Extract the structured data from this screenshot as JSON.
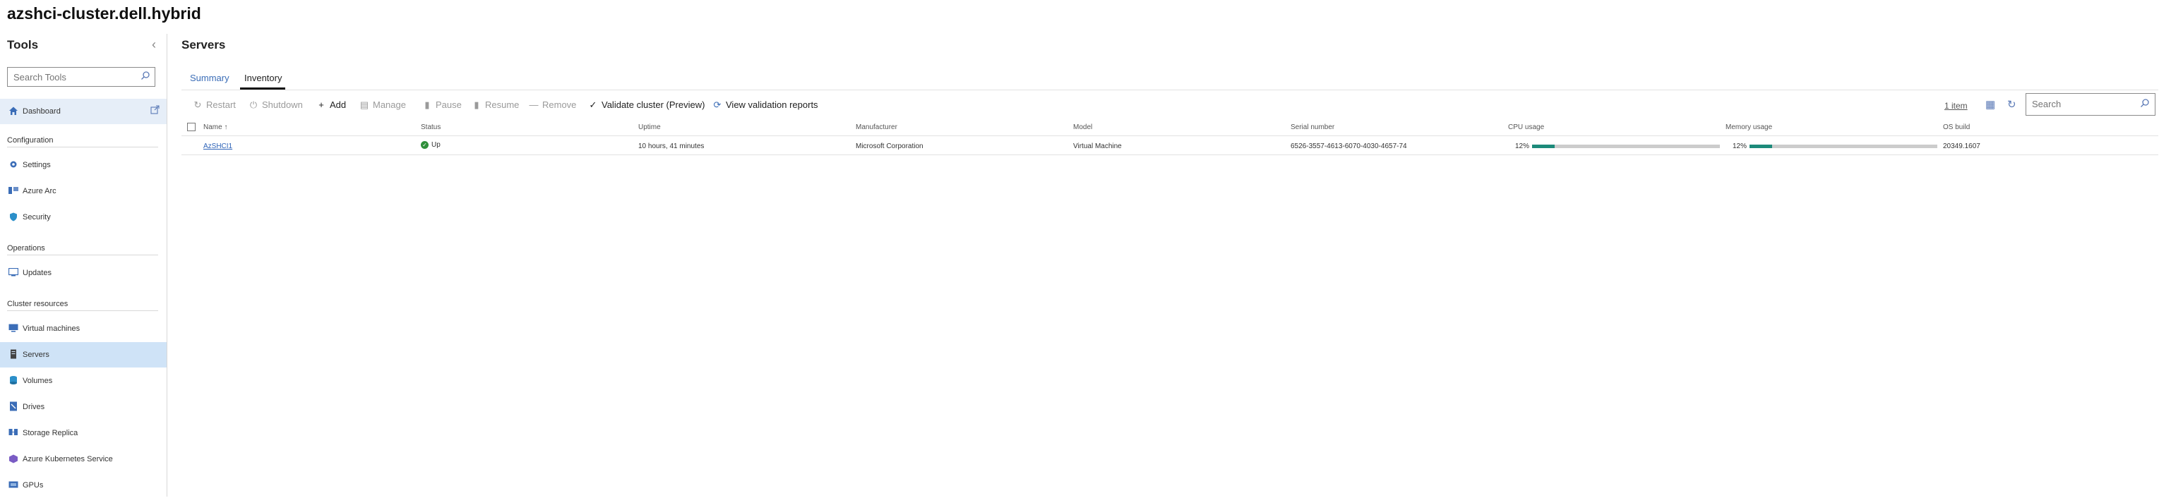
{
  "app": {
    "title": "azshci-cluster.dell.hybrid"
  },
  "sidebar": {
    "title": "Tools",
    "search_placeholder": "Search Tools",
    "dashboard": {
      "label": "Dashboard"
    },
    "sections": [
      {
        "heading": "Configuration",
        "items": [
          {
            "label": "Settings"
          },
          {
            "label": "Azure Arc"
          },
          {
            "label": "Security"
          }
        ]
      },
      {
        "heading": "Operations",
        "items": [
          {
            "label": "Updates"
          }
        ]
      },
      {
        "heading": "Cluster resources",
        "items": [
          {
            "label": "Virtual machines"
          },
          {
            "label": "Servers"
          },
          {
            "label": "Volumes"
          },
          {
            "label": "Drives"
          },
          {
            "label": "Storage Replica"
          },
          {
            "label": "Azure Kubernetes Service"
          },
          {
            "label": "GPUs"
          }
        ]
      }
    ]
  },
  "main": {
    "title": "Servers",
    "tabs": [
      {
        "label": "Summary"
      },
      {
        "label": "Inventory"
      }
    ],
    "toolbar": {
      "restart": "Restart",
      "shutdown": "Shutdown",
      "add": "Add",
      "manage": "Manage",
      "pause": "Pause",
      "resume": "Resume",
      "remove": "Remove",
      "validate": "Validate cluster (Preview)",
      "view_reports": "View validation reports"
    },
    "item_count": "1 item",
    "search_placeholder": "Search",
    "columns": [
      "Name ↑",
      "Status",
      "Uptime",
      "Manufacturer",
      "Model",
      "Serial number",
      "CPU usage",
      "Memory usage",
      "OS build"
    ],
    "rows": [
      {
        "name": "AzSHCI1",
        "status": "Up",
        "uptime": "10 hours, 41 minutes",
        "manufacturer": "Microsoft Corporation",
        "model": "Virtual Machine",
        "serial": "6526-3557-4613-6070-4030-4657-74",
        "cpu_text": "12%",
        "cpu_value": 0.12,
        "memory_text": "12%",
        "memory_value": 0.12,
        "os_build": "20349.1607"
      }
    ]
  },
  "colors": {
    "accent": "#3b6db7",
    "active_nav": "#cfe3f7",
    "bar_fill": "#1c8a7a",
    "status_up": "#2f8f3a"
  }
}
